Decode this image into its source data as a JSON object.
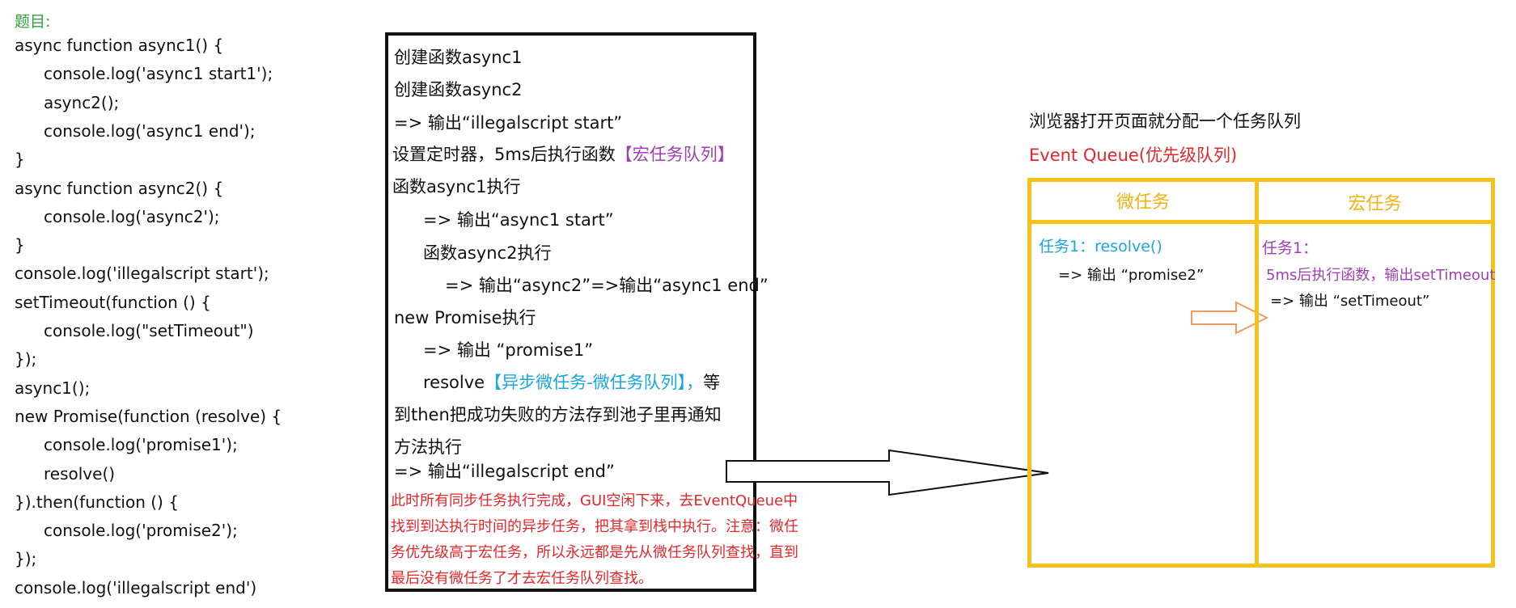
{
  "code": {
    "title": "题目:",
    "lines": [
      {
        "text": "async function async1() {",
        "indent": 0
      },
      {
        "text": "console.log('async1 start1');",
        "indent": 1
      },
      {
        "text": "async2();",
        "indent": 1
      },
      {
        "text": "console.log('async1 end');",
        "indent": 1
      },
      {
        "text": "}",
        "indent": 0
      },
      {
        "text": "async function async2() {",
        "indent": 0
      },
      {
        "text": "console.log('async2');",
        "indent": 1
      },
      {
        "text": "}",
        "indent": 0
      },
      {
        "text": "console.log('illegalscript start');",
        "indent": 0
      },
      {
        "text": "setTimeout(function () {",
        "indent": 0
      },
      {
        "text": "console.log(\"setTimeout\")",
        "indent": 1
      },
      {
        "text": "});",
        "indent": 0
      },
      {
        "text": "async1();",
        "indent": 0
      },
      {
        "text": "new Promise(function (resolve) {",
        "indent": 0
      },
      {
        "text": "console.log('promise1');",
        "indent": 1
      },
      {
        "text": "resolve()",
        "indent": 1
      },
      {
        "text": "}).then(function () {",
        "indent": 0
      },
      {
        "text": "console.log('promise2');",
        "indent": 1
      },
      {
        "text": "});",
        "indent": 0
      },
      {
        "text": "console.log('illegalscript end')",
        "indent": 0
      }
    ]
  },
  "explanation": {
    "l1": "创建函数async1",
    "l2": "创建函数async2",
    "l3": "=> 输出“illegalscript start”",
    "l4a": "设置定时器，5ms后执行函数",
    "l4b": "【宏任务队列】",
    "l5": "函数async1执行",
    "l6": "=> 输出“async1 start”",
    "l7": "函数async2执行",
    "l8": "=> 输出“async2”=>输出“async1 end”",
    "l9": "new Promise执行",
    "l10": "=> 输出 “promise1”",
    "l11a": "resolve",
    "l11b": "【异步微任务-微任务队列】，",
    "l11c": "等",
    "l12": "到then把成功失败的方法存到池子里再通知",
    "l13": "方法执行",
    "l14": "=> 输出“illegalscript end”",
    "note1": "此时所有同步任务执行完成，GUI空闲下来，去EventQueue中",
    "note2": "找到到达执行时间的异步任务，把其拿到栈中执行。注意：微任",
    "note3": "务优先级高于宏任务，所以永远都是先从微任务队列查找，直到",
    "note4": "最后没有微任务了才去宏任务队列查找。"
  },
  "browser": {
    "text": "浏览器打开页面就分配一个任务队列",
    "queue_label": "Event Queue(优先级队列)"
  },
  "queue": {
    "micro_header": "微任务",
    "macro_header": "宏任务",
    "micro_task_title": "任务1：resolve()",
    "micro_task_output": "=> 输出 “promise2”",
    "macro_task_title": "任务1：",
    "macro_task_desc": "5ms后执行函数，输出setTimeout",
    "macro_task_output": "=> 输出 “setTimeout”"
  },
  "colors": {
    "green": "#2fa33a",
    "purple": "#a03fb0",
    "blue": "#18a6e3",
    "red": "#e3262b",
    "yellow": "#f5c21a",
    "orange_arrow": "#f29b5c"
  }
}
